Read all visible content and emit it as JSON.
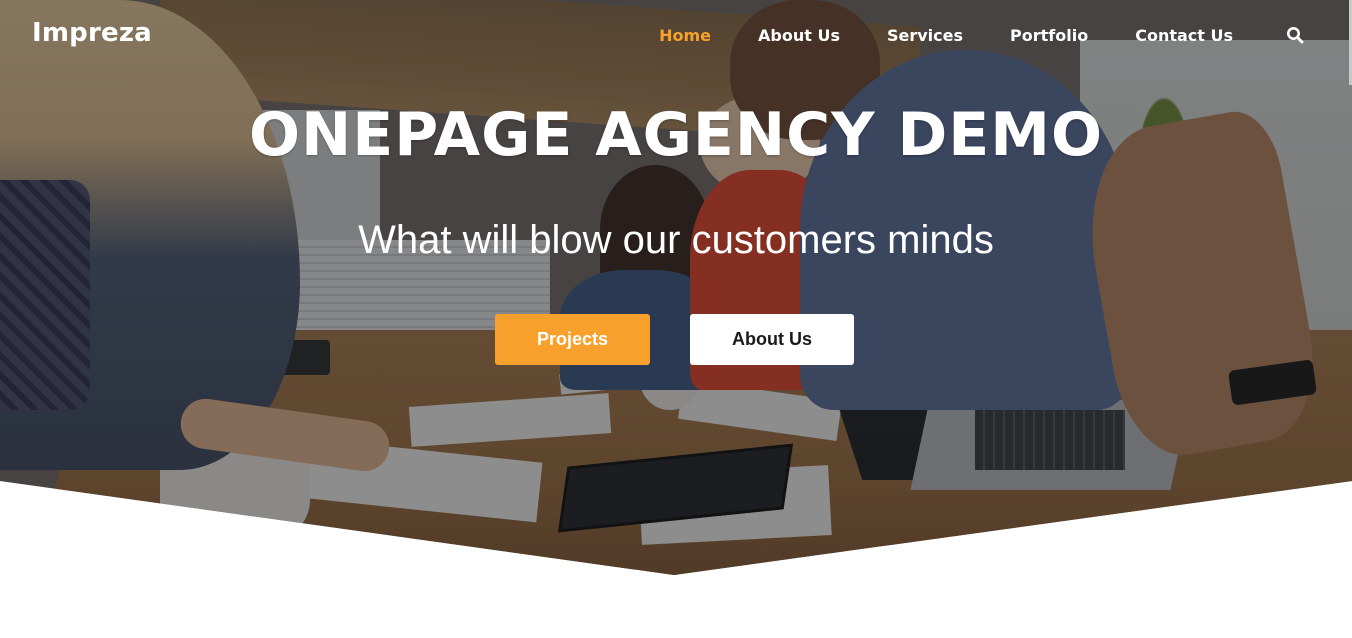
{
  "header": {
    "logo": "Impreza",
    "nav": [
      {
        "label": "Home",
        "active": true
      },
      {
        "label": "About Us",
        "active": false
      },
      {
        "label": "Services",
        "active": false
      },
      {
        "label": "Portfolio",
        "active": false
      },
      {
        "label": "Contact Us",
        "active": false
      }
    ],
    "search_icon": "search-icon"
  },
  "hero": {
    "title": "ONEPAGE AGENCY DEMO",
    "subtitle": "What will blow our customers minds",
    "buttons": {
      "primary": "Projects",
      "secondary": "About Us"
    }
  },
  "colors": {
    "accent": "#f7a12c",
    "text_light": "#ffffff",
    "button_secondary_bg": "#ffffff",
    "button_secondary_text": "#1a1a1a"
  }
}
